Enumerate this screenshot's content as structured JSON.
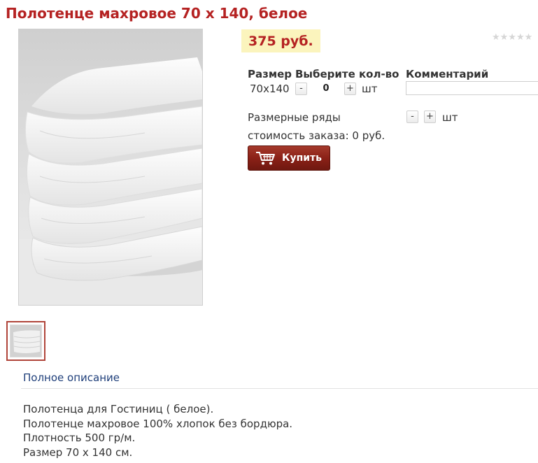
{
  "product": {
    "title": "Полотенце махровое 70 х 140, белое",
    "price": "375 руб.",
    "rating_stars": "★★★★★",
    "image_alt": "towel stack photo"
  },
  "options": {
    "headers": {
      "size": "Размер",
      "qty": "Выберите кол-во",
      "comment": "Комментарий"
    },
    "rows": [
      {
        "size": "70x140",
        "minus": "-",
        "qty": "0",
        "plus": "+",
        "unit": "шт",
        "comment_placeholder": ""
      }
    ],
    "size_range": {
      "label": "Размерные ряды",
      "minus": "-",
      "plus": "+",
      "unit": "шт"
    },
    "order_total": "стоимость заказа: 0 руб."
  },
  "buy_button": {
    "label": "Купить",
    "icon": "cart-icon"
  },
  "tabs": {
    "full_description": "Полное описание"
  },
  "description": [
    "Полотенца для Гостиниц ( белое).",
    "Полотенце махровое 100% хлопок без бордюра.",
    "Плотность 500 гр/м.",
    "Размер 70 х 140 см."
  ],
  "colors": {
    "title": "#b52222",
    "price_bg": "#fbf4bd",
    "buy_button": "#8b2117",
    "link": "#1f3f7a"
  }
}
